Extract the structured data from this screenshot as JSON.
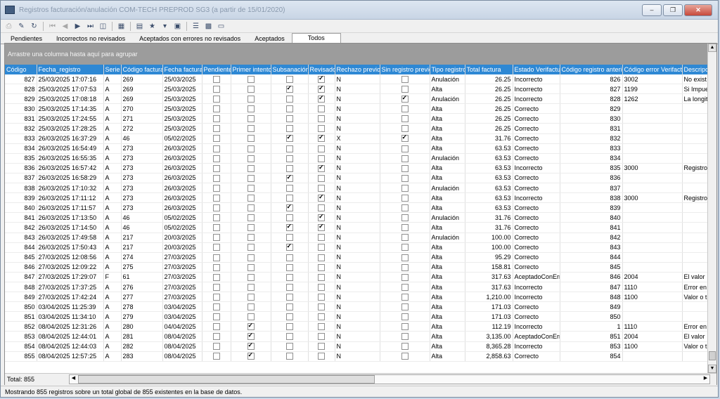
{
  "window": {
    "title": "Registros facturación/anulación COM-TECH PREPROD SG3 (a partir de 15/01/2020)"
  },
  "toolbar": {
    "icons": [
      "print-icon",
      "pin-icon",
      "refresh-icon",
      "first-icon",
      "prev-icon",
      "next-icon",
      "last-icon",
      "preview-icon",
      "export-icon",
      "book-icon",
      "filter-icon",
      "dropdown-icon",
      "card-icon",
      "list-icon",
      "table-icon",
      "window-icon"
    ]
  },
  "tabs": [
    "Pendientes",
    "Incorrectos no revisados",
    "Aceptados con errores no revisados",
    "Aceptados",
    "Todos"
  ],
  "active_tab": "Todos",
  "grid": {
    "group_hint": "Arrastre una columna hasta aquí para agrupar",
    "columns": [
      "Código",
      "Fecha_registro",
      "Serie",
      "Código factura",
      "Fecha factura",
      "Pendiente",
      "Primer intento",
      "Subsanación",
      "Revisado",
      "Rechazo previo",
      "Sin registro previo",
      "Tipo registro",
      "Total factura",
      "Estado Verifactu",
      "Código registro anterior",
      "Código error Verifactu",
      "Descripción"
    ],
    "rows": [
      {
        "codigo": "827",
        "fecha": "25/03/2025 17:07:16",
        "serie": "A",
        "cod_fact": "269",
        "fecha_fact": "25/03/2025",
        "pend": false,
        "primer": false,
        "subs": false,
        "rev": true,
        "rech": "N",
        "sin": false,
        "tipo": "Anulación",
        "total": "26.25",
        "estado": "Incorrecto",
        "anterior": "826",
        "error": "3002",
        "desc": "No exist"
      },
      {
        "codigo": "828",
        "fecha": "25/03/2025 17:07:53",
        "serie": "A",
        "cod_fact": "269",
        "fecha_fact": "25/03/2025",
        "pend": false,
        "primer": false,
        "subs": true,
        "rev": true,
        "rech": "N",
        "sin": false,
        "tipo": "Alta",
        "total": "26.25",
        "estado": "Incorrecto",
        "anterior": "827",
        "error": "1199",
        "desc": "Si Impue"
      },
      {
        "codigo": "829",
        "fecha": "25/03/2025 17:08:18",
        "serie": "A",
        "cod_fact": "269",
        "fecha_fact": "25/03/2025",
        "pend": false,
        "primer": false,
        "subs": false,
        "rev": true,
        "rech": "N",
        "sin": true,
        "tipo": "Anulación",
        "total": "26.25",
        "estado": "Incorrecto",
        "anterior": "828",
        "error": "1262",
        "desc": "La longit"
      },
      {
        "codigo": "830",
        "fecha": "25/03/2025 17:14:35",
        "serie": "A",
        "cod_fact": "270",
        "fecha_fact": "25/03/2025",
        "pend": false,
        "primer": false,
        "subs": false,
        "rev": false,
        "rech": "N",
        "sin": false,
        "tipo": "Alta",
        "total": "26.25",
        "estado": "Correcto",
        "anterior": "829",
        "error": "",
        "desc": ""
      },
      {
        "codigo": "831",
        "fecha": "25/03/2025 17:24:55",
        "serie": "A",
        "cod_fact": "271",
        "fecha_fact": "25/03/2025",
        "pend": false,
        "primer": false,
        "subs": false,
        "rev": false,
        "rech": "N",
        "sin": false,
        "tipo": "Alta",
        "total": "26.25",
        "estado": "Correcto",
        "anterior": "830",
        "error": "",
        "desc": ""
      },
      {
        "codigo": "832",
        "fecha": "25/03/2025 17:28:25",
        "serie": "A",
        "cod_fact": "272",
        "fecha_fact": "25/03/2025",
        "pend": false,
        "primer": false,
        "subs": false,
        "rev": false,
        "rech": "N",
        "sin": false,
        "tipo": "Alta",
        "total": "26.25",
        "estado": "Correcto",
        "anterior": "831",
        "error": "",
        "desc": ""
      },
      {
        "codigo": "833",
        "fecha": "26/03/2025 16:37:29",
        "serie": "A",
        "cod_fact": "46",
        "fecha_fact": "05/02/2025",
        "pend": false,
        "primer": false,
        "subs": true,
        "rev": true,
        "rech": "X",
        "sin": true,
        "tipo": "Alta",
        "total": "31.76",
        "estado": "Correcto",
        "anterior": "832",
        "error": "",
        "desc": ""
      },
      {
        "codigo": "834",
        "fecha": "26/03/2025 16:54:49",
        "serie": "A",
        "cod_fact": "273",
        "fecha_fact": "26/03/2025",
        "pend": false,
        "primer": false,
        "subs": false,
        "rev": false,
        "rech": "N",
        "sin": false,
        "tipo": "Alta",
        "total": "63.53",
        "estado": "Correcto",
        "anterior": "833",
        "error": "",
        "desc": ""
      },
      {
        "codigo": "835",
        "fecha": "26/03/2025 16:55:35",
        "serie": "A",
        "cod_fact": "273",
        "fecha_fact": "26/03/2025",
        "pend": false,
        "primer": false,
        "subs": false,
        "rev": false,
        "rech": "N",
        "sin": false,
        "tipo": "Anulación",
        "total": "63.53",
        "estado": "Correcto",
        "anterior": "834",
        "error": "",
        "desc": ""
      },
      {
        "codigo": "836",
        "fecha": "26/03/2025 16:57:42",
        "serie": "A",
        "cod_fact": "273",
        "fecha_fact": "26/03/2025",
        "pend": false,
        "primer": false,
        "subs": false,
        "rev": true,
        "rech": "N",
        "sin": false,
        "tipo": "Alta",
        "total": "63.53",
        "estado": "Incorrecto",
        "anterior": "835",
        "error": "3000",
        "desc": "Registro"
      },
      {
        "codigo": "837",
        "fecha": "26/03/2025 16:58:29",
        "serie": "A",
        "cod_fact": "273",
        "fecha_fact": "26/03/2025",
        "pend": false,
        "primer": false,
        "subs": true,
        "rev": false,
        "rech": "N",
        "sin": false,
        "tipo": "Alta",
        "total": "63.53",
        "estado": "Correcto",
        "anterior": "836",
        "error": "",
        "desc": ""
      },
      {
        "codigo": "838",
        "fecha": "26/03/2025 17:10:32",
        "serie": "A",
        "cod_fact": "273",
        "fecha_fact": "26/03/2025",
        "pend": false,
        "primer": false,
        "subs": false,
        "rev": false,
        "rech": "N",
        "sin": false,
        "tipo": "Anulación",
        "total": "63.53",
        "estado": "Correcto",
        "anterior": "837",
        "error": "",
        "desc": ""
      },
      {
        "codigo": "839",
        "fecha": "26/03/2025 17:11:12",
        "serie": "A",
        "cod_fact": "273",
        "fecha_fact": "26/03/2025",
        "pend": false,
        "primer": false,
        "subs": false,
        "rev": true,
        "rech": "N",
        "sin": false,
        "tipo": "Alta",
        "total": "63.53",
        "estado": "Incorrecto",
        "anterior": "838",
        "error": "3000",
        "desc": "Registro"
      },
      {
        "codigo": "840",
        "fecha": "26/03/2025 17:11:57",
        "serie": "A",
        "cod_fact": "273",
        "fecha_fact": "26/03/2025",
        "pend": false,
        "primer": false,
        "subs": true,
        "rev": false,
        "rech": "N",
        "sin": false,
        "tipo": "Alta",
        "total": "63.53",
        "estado": "Correcto",
        "anterior": "839",
        "error": "",
        "desc": ""
      },
      {
        "codigo": "841",
        "fecha": "26/03/2025 17:13:50",
        "serie": "A",
        "cod_fact": "46",
        "fecha_fact": "05/02/2025",
        "pend": false,
        "primer": false,
        "subs": false,
        "rev": true,
        "rech": "N",
        "sin": false,
        "tipo": "Anulación",
        "total": "31.76",
        "estado": "Correcto",
        "anterior": "840",
        "error": "",
        "desc": ""
      },
      {
        "codigo": "842",
        "fecha": "26/03/2025 17:14:50",
        "serie": "A",
        "cod_fact": "46",
        "fecha_fact": "05/02/2025",
        "pend": false,
        "primer": false,
        "subs": true,
        "rev": true,
        "rech": "N",
        "sin": false,
        "tipo": "Alta",
        "total": "31.76",
        "estado": "Correcto",
        "anterior": "841",
        "error": "",
        "desc": ""
      },
      {
        "codigo": "843",
        "fecha": "26/03/2025 17:49:58",
        "serie": "A",
        "cod_fact": "217",
        "fecha_fact": "20/03/2025",
        "pend": false,
        "primer": false,
        "subs": false,
        "rev": false,
        "rech": "N",
        "sin": false,
        "tipo": "Anulación",
        "total": "100.00",
        "estado": "Correcto",
        "anterior": "842",
        "error": "",
        "desc": ""
      },
      {
        "codigo": "844",
        "fecha": "26/03/2025 17:50:43",
        "serie": "A",
        "cod_fact": "217",
        "fecha_fact": "20/03/2025",
        "pend": false,
        "primer": false,
        "subs": true,
        "rev": false,
        "rech": "N",
        "sin": false,
        "tipo": "Alta",
        "total": "100.00",
        "estado": "Correcto",
        "anterior": "843",
        "error": "",
        "desc": ""
      },
      {
        "codigo": "845",
        "fecha": "27/03/2025 12:08:56",
        "serie": "A",
        "cod_fact": "274",
        "fecha_fact": "27/03/2025",
        "pend": false,
        "primer": false,
        "subs": false,
        "rev": false,
        "rech": "N",
        "sin": false,
        "tipo": "Alta",
        "total": "95.29",
        "estado": "Correcto",
        "anterior": "844",
        "error": "",
        "desc": ""
      },
      {
        "codigo": "846",
        "fecha": "27/03/2025 12:09:22",
        "serie": "A",
        "cod_fact": "275",
        "fecha_fact": "27/03/2025",
        "pend": false,
        "primer": false,
        "subs": false,
        "rev": false,
        "rech": "N",
        "sin": false,
        "tipo": "Alta",
        "total": "158.81",
        "estado": "Correcto",
        "anterior": "845",
        "error": "",
        "desc": ""
      },
      {
        "codigo": "847",
        "fecha": "27/03/2025 17:29:07",
        "serie": "F",
        "cod_fact": "61",
        "fecha_fact": "27/03/2025",
        "pend": false,
        "primer": false,
        "subs": false,
        "rev": false,
        "rech": "N",
        "sin": false,
        "tipo": "Alta",
        "total": "317.63",
        "estado": "AceptadoConErr",
        "anterior": "846",
        "error": "2004",
        "desc": "El valor"
      },
      {
        "codigo": "848",
        "fecha": "27/03/2025 17:37:25",
        "serie": "A",
        "cod_fact": "276",
        "fecha_fact": "27/03/2025",
        "pend": false,
        "primer": false,
        "subs": false,
        "rev": false,
        "rech": "N",
        "sin": false,
        "tipo": "Alta",
        "total": "317.63",
        "estado": "Incorrecto",
        "anterior": "847",
        "error": "1110",
        "desc": "Error en"
      },
      {
        "codigo": "849",
        "fecha": "27/03/2025 17:42:24",
        "serie": "A",
        "cod_fact": "277",
        "fecha_fact": "27/03/2025",
        "pend": false,
        "primer": false,
        "subs": false,
        "rev": false,
        "rech": "N",
        "sin": false,
        "tipo": "Alta",
        "total": "1,210.00",
        "estado": "Incorrecto",
        "anterior": "848",
        "error": "1100",
        "desc": "Valor o t"
      },
      {
        "codigo": "850",
        "fecha": "03/04/2025 11:25:39",
        "serie": "A",
        "cod_fact": "278",
        "fecha_fact": "03/04/2025",
        "pend": false,
        "primer": false,
        "subs": false,
        "rev": false,
        "rech": "N",
        "sin": false,
        "tipo": "Alta",
        "total": "171.03",
        "estado": "Correcto",
        "anterior": "849",
        "error": "",
        "desc": ""
      },
      {
        "codigo": "851",
        "fecha": "03/04/2025 11:34:10",
        "serie": "A",
        "cod_fact": "279",
        "fecha_fact": "03/04/2025",
        "pend": false,
        "primer": false,
        "subs": false,
        "rev": false,
        "rech": "N",
        "sin": false,
        "tipo": "Alta",
        "total": "171.03",
        "estado": "Correcto",
        "anterior": "850",
        "error": "",
        "desc": ""
      },
      {
        "codigo": "852",
        "fecha": "08/04/2025 12:31:26",
        "serie": "A",
        "cod_fact": "280",
        "fecha_fact": "04/04/2025",
        "pend": false,
        "primer": true,
        "subs": false,
        "rev": false,
        "rech": "N",
        "sin": false,
        "tipo": "Alta",
        "total": "112.19",
        "estado": "Incorrecto",
        "anterior": "1",
        "error": "1110",
        "desc": "Error en"
      },
      {
        "codigo": "853",
        "fecha": "08/04/2025 12:44:01",
        "serie": "A",
        "cod_fact": "281",
        "fecha_fact": "08/04/2025",
        "pend": false,
        "primer": true,
        "subs": false,
        "rev": false,
        "rech": "N",
        "sin": false,
        "tipo": "Alta",
        "total": "3,135.00",
        "estado": "AceptadoConErr",
        "anterior": "851",
        "error": "2004",
        "desc": "El valor"
      },
      {
        "codigo": "854",
        "fecha": "08/04/2025 12:44:03",
        "serie": "A",
        "cod_fact": "282",
        "fecha_fact": "08/04/2025",
        "pend": false,
        "primer": true,
        "subs": false,
        "rev": false,
        "rech": "N",
        "sin": false,
        "tipo": "Alta",
        "total": "8,365.28",
        "estado": "Incorrecto",
        "anterior": "853",
        "error": "1100",
        "desc": "Valor o t"
      },
      {
        "codigo": "855",
        "fecha": "08/04/2025 12:57:25",
        "serie": "A",
        "cod_fact": "283",
        "fecha_fact": "08/04/2025",
        "pend": false,
        "primer": true,
        "subs": false,
        "rev": false,
        "rech": "N",
        "sin": false,
        "tipo": "Alta",
        "total": "2,858.63",
        "estado": "Correcto",
        "anterior": "854",
        "error": "",
        "desc": ""
      }
    ],
    "total_label": "Total: 855"
  },
  "status": {
    "text": "Mostrando 855 registros sobre un total global de 855 existentes en la base de datos."
  },
  "colors": {
    "header_bg": "#2e88d4",
    "group_area_bg": "#9c9c9c"
  }
}
